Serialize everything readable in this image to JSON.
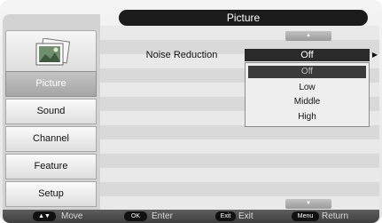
{
  "header": {
    "title": "Picture"
  },
  "sidebar": {
    "icon": "photos-icon",
    "items": [
      {
        "label": "Picture",
        "active": true
      },
      {
        "label": "Sound",
        "active": false
      },
      {
        "label": "Channel",
        "active": false
      },
      {
        "label": "Feature",
        "active": false
      },
      {
        "label": "Setup",
        "active": false
      }
    ]
  },
  "content": {
    "scroll_up_icon": "chevron-up-icon",
    "scroll_down_icon": "chevron-down-icon",
    "setting": {
      "label": "Noise Reduction",
      "value": "Off",
      "arrow_icon": "chevron-right-icon"
    },
    "dropdown": {
      "options": [
        "Off",
        "Low",
        "Middle",
        "High"
      ],
      "selected_index": 0
    }
  },
  "footer": {
    "hints": [
      {
        "key": "▲▼",
        "action": "Move"
      },
      {
        "key": "OK",
        "action": "Enter"
      },
      {
        "key": "Exit",
        "action": "Exit"
      },
      {
        "key": "Menu",
        "action": "Return"
      }
    ]
  },
  "colors": {
    "title_bar": "#1b1b1b",
    "active_item": "#b2b2b2",
    "value_bar": "#2a2a2a",
    "footer": "#4a4a4a"
  }
}
